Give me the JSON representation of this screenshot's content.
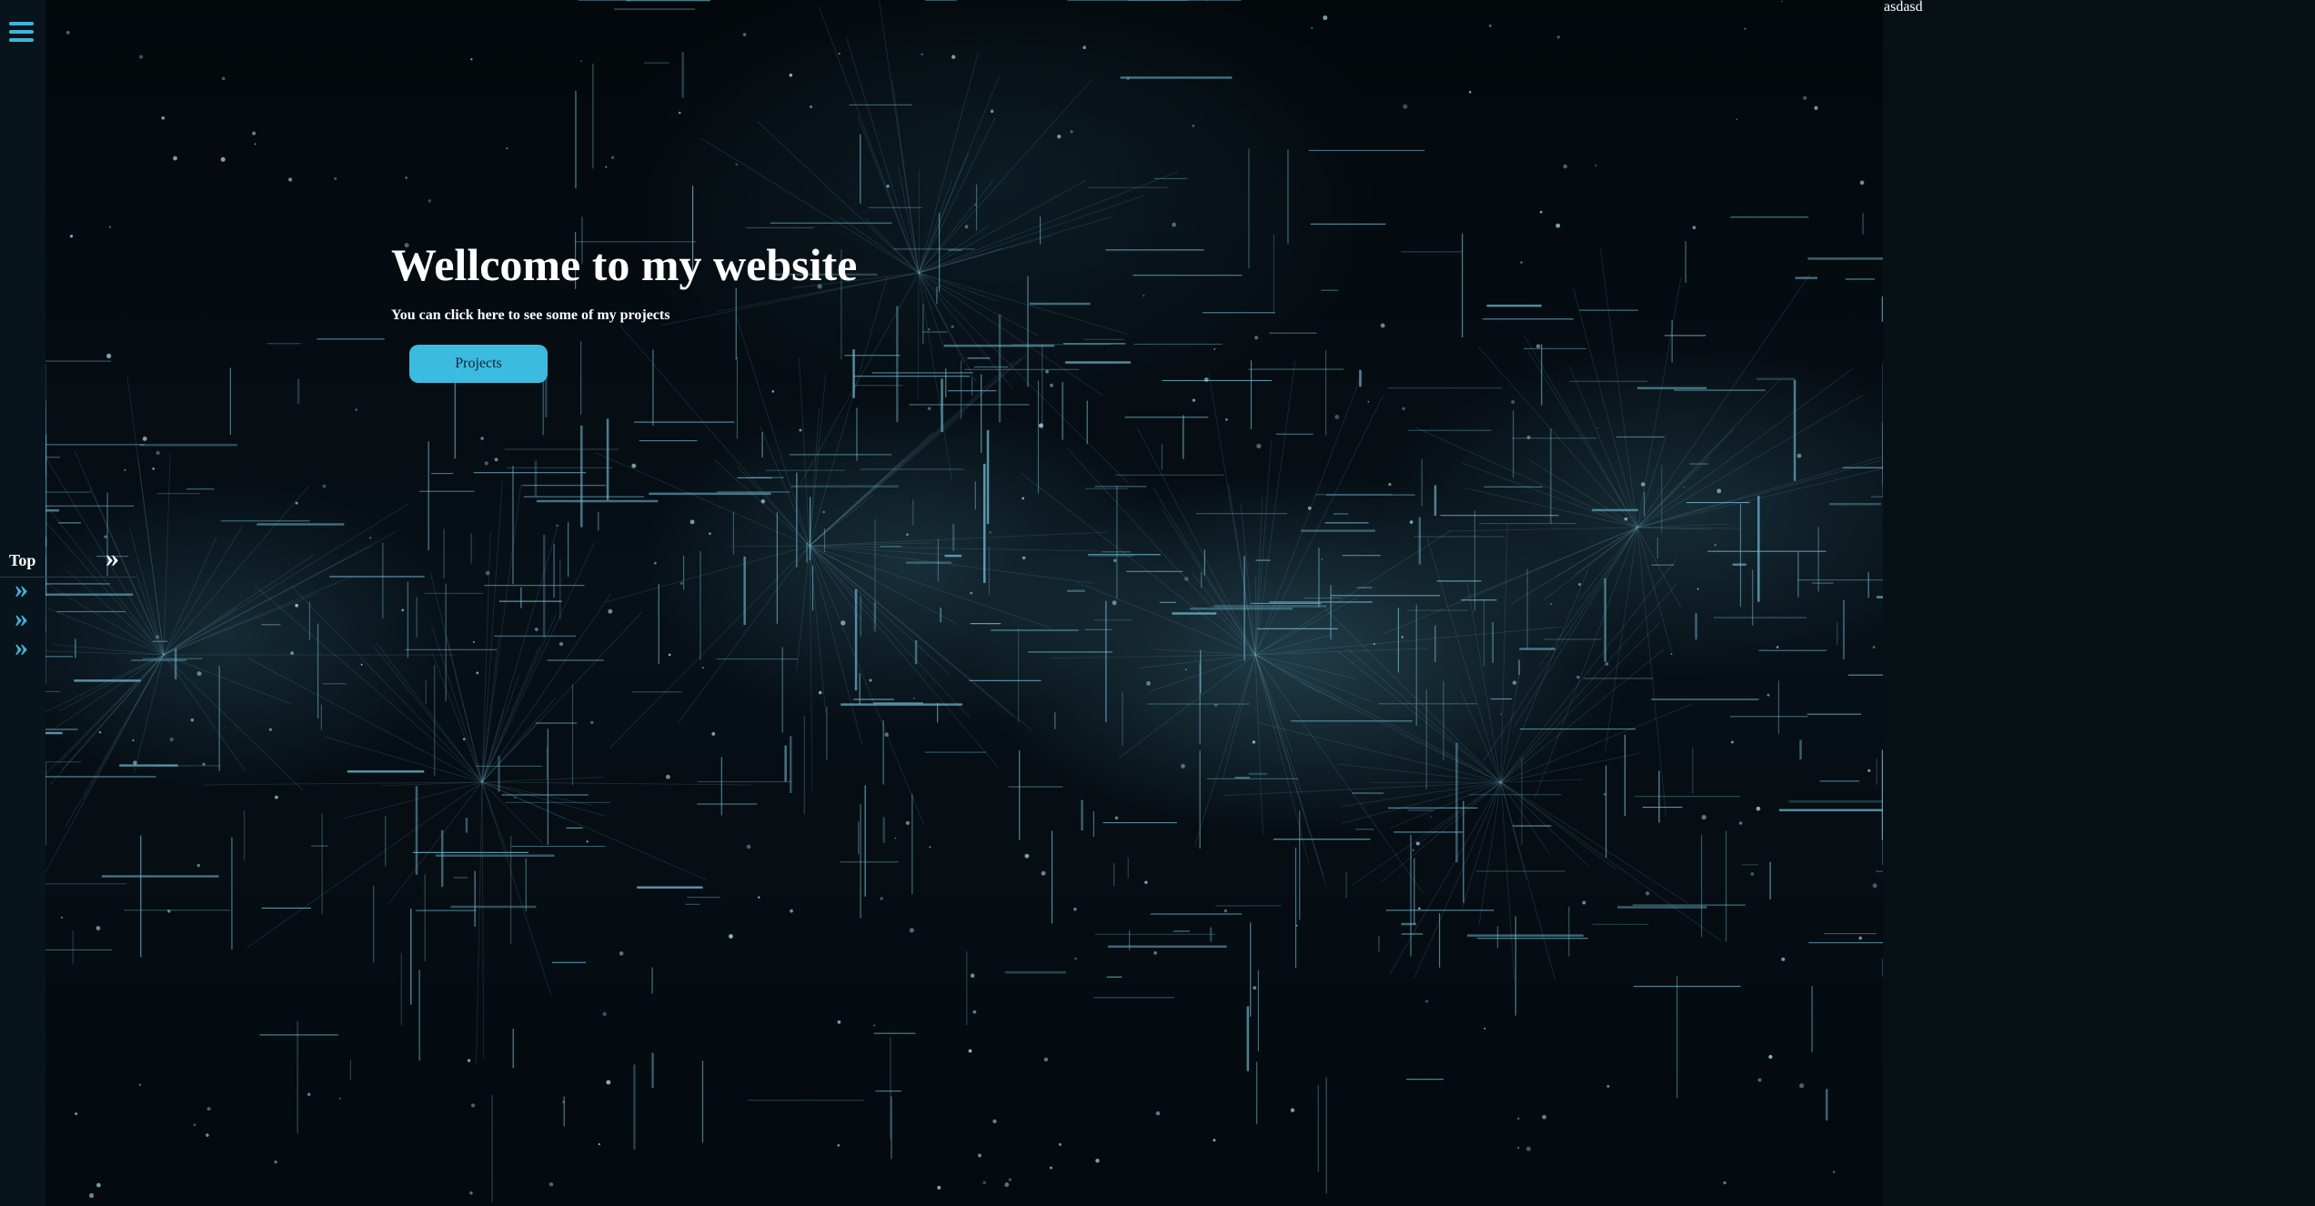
{
  "nav": {
    "menu_icon": "hamburger-icon",
    "top_label": "Top",
    "chevron": "»",
    "link_chevrons": [
      "»",
      "»",
      "»"
    ]
  },
  "hero": {
    "title": "Wellcome to my website",
    "subtitle": "You can click here to see some of my projects",
    "button_label": "Projects",
    "background": "network-lines-background"
  },
  "right_panel": {
    "text": "asdasd"
  },
  "colors": {
    "accent": "#3bbbe0",
    "sidebar_bg": "#07141b",
    "page_bg": "#071014",
    "hero_dark": "#03080b"
  }
}
